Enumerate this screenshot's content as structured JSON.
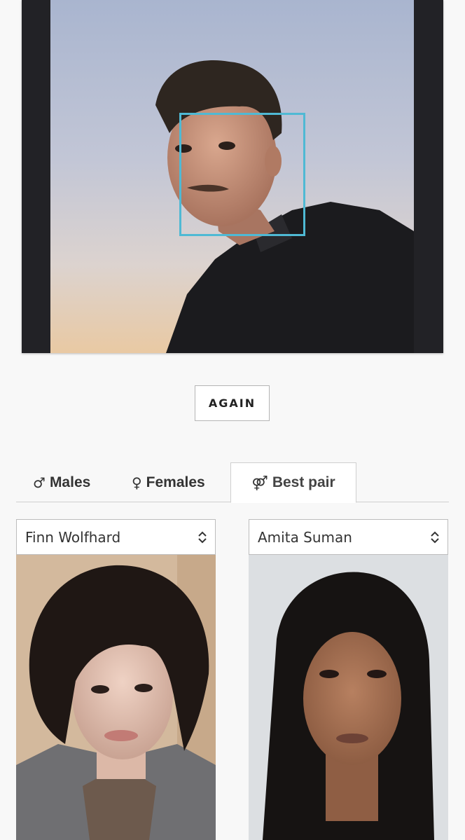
{
  "main_photo": {
    "image": "selfie-photo",
    "face_box_color": "#4fb9d4"
  },
  "again_button": {
    "label": "AGAIN"
  },
  "tabs": [
    {
      "symbol": "♂",
      "label": "Males",
      "active": false
    },
    {
      "symbol": "♀",
      "label": "Females",
      "active": false
    },
    {
      "symbol": "⚤",
      "label": "Best pair",
      "active": true
    }
  ],
  "matches": {
    "left": {
      "selected": "Finn Wolfhard",
      "image": "celebrity-portrait-male"
    },
    "right": {
      "selected": "Amita Suman",
      "image": "celebrity-portrait-female"
    }
  }
}
